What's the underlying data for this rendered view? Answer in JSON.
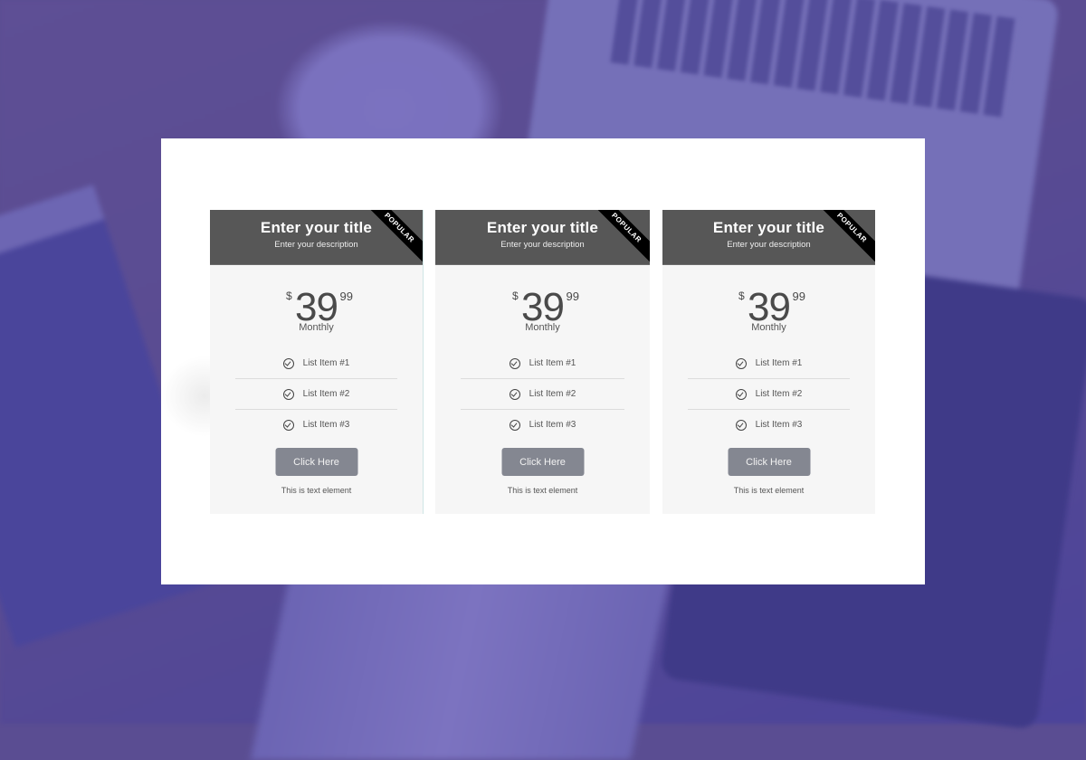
{
  "pricing_cards": [
    {
      "title": "Enter your title",
      "description": "Enter your description",
      "badge": "POPULAR",
      "currency": "$",
      "amount": "39",
      "cents": "99",
      "period": "Monthly",
      "items": [
        "List Item #1",
        "List Item #2",
        "List Item #3"
      ],
      "button_label": "Click Here",
      "footer_text": "This is text element"
    },
    {
      "title": "Enter your title",
      "description": "Enter your description",
      "badge": "POPULAR",
      "currency": "$",
      "amount": "39",
      "cents": "99",
      "period": "Monthly",
      "items": [
        "List Item #1",
        "List Item #2",
        "List Item #3"
      ],
      "button_label": "Click Here",
      "footer_text": "This is text element"
    },
    {
      "title": "Enter your title",
      "description": "Enter your description",
      "badge": "POPULAR",
      "currency": "$",
      "amount": "39",
      "cents": "99",
      "period": "Monthly",
      "items": [
        "List Item #1",
        "List Item #2",
        "List Item #3"
      ],
      "button_label": "Click Here",
      "footer_text": "This is text element"
    }
  ],
  "icons": {
    "list_item": "check-circle-icon"
  },
  "colors": {
    "header_bg": "#575757",
    "card_bg": "#f6f6f6",
    "button_bg": "#848791",
    "ribbon_bg": "#000000",
    "background_tint": "#5a4d92"
  }
}
